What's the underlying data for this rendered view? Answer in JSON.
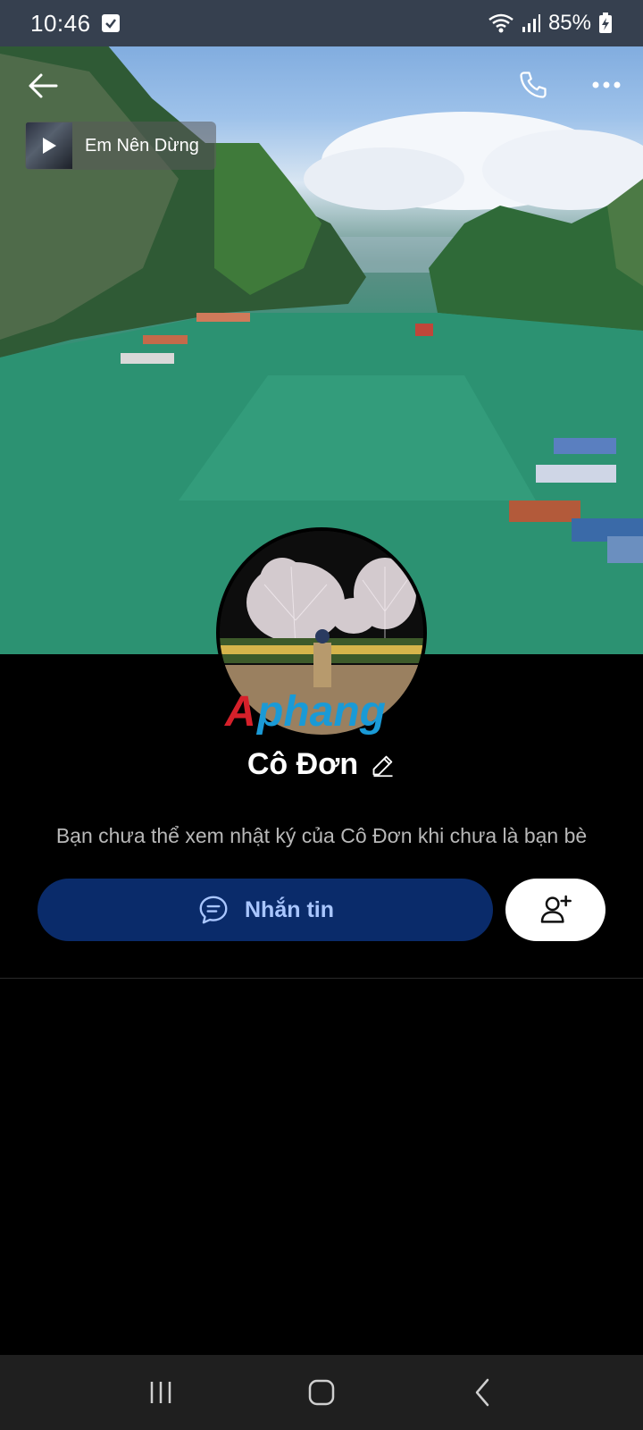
{
  "status_bar": {
    "time": "10:46",
    "battery": "85%"
  },
  "header": {
    "back_icon": "arrow-left-icon",
    "call_icon": "phone-icon",
    "more_icon": "more-horizontal-icon"
  },
  "music": {
    "title": "Em Nên Dừng"
  },
  "profile": {
    "name": "Cô Đơn",
    "watermark": "Aphang",
    "notice": "Bạn chưa thể xem nhật ký của Cô Đơn khi chưa là bạn bè"
  },
  "actions": {
    "message_label": "Nhắn tin",
    "message_icon": "chat-bubble-icon",
    "add_friend_icon": "add-user-icon"
  },
  "navbar": {
    "recents_icon": "recents-icon",
    "home_icon": "home-icon",
    "back_icon": "back-chevron-icon"
  },
  "colors": {
    "status_bar": "#36404f",
    "message_button": "#0a2b6a",
    "message_text": "#a9c6ff",
    "background": "#000000"
  }
}
